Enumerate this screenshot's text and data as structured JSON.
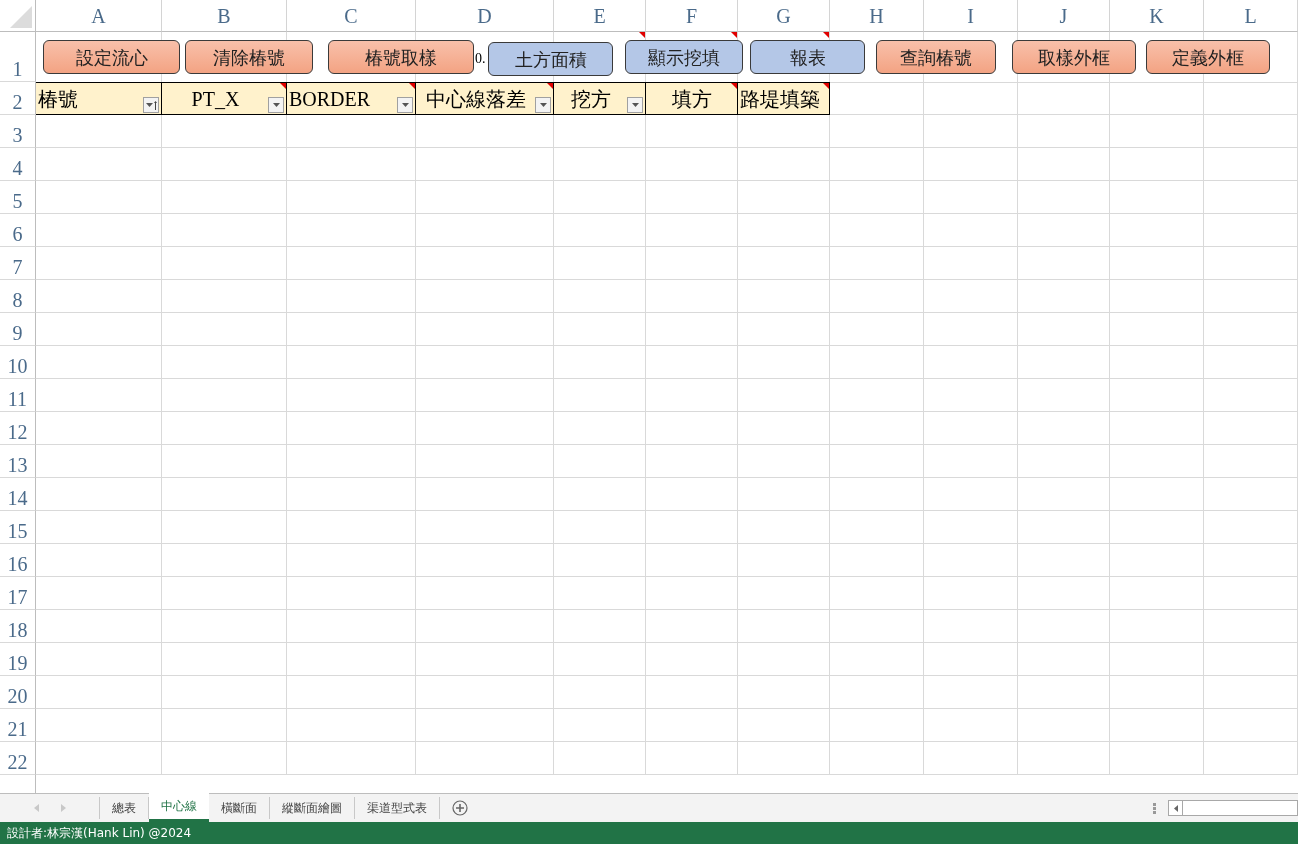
{
  "columns": [
    "A",
    "B",
    "C",
    "D",
    "E",
    "F",
    "G",
    "H",
    "I",
    "J",
    "K",
    "L"
  ],
  "row_numbers": [
    "1",
    "2",
    "3",
    "4",
    "5",
    "6",
    "7",
    "8",
    "9",
    "10",
    "11",
    "12",
    "13",
    "14",
    "15",
    "16",
    "17",
    "18",
    "19",
    "20",
    "21",
    "22"
  ],
  "row1_cells": [
    {
      "text": "0."
    },
    {
      "comment": true
    },
    {
      "comment": true
    },
    {
      "comment": true
    }
  ],
  "header_cells": [
    {
      "text": "椿號",
      "filter_button": true,
      "sorted": true,
      "comment": false
    },
    {
      "text": "PT_X",
      "filter_button": true,
      "sorted": false,
      "comment": true
    },
    {
      "text": "BORDER",
      "filter_button": true,
      "sorted": false,
      "comment": true
    },
    {
      "text": "中心線落差",
      "filter_button": true,
      "sorted": false,
      "comment": true
    },
    {
      "text": "挖方",
      "filter_button": true,
      "sorted": false,
      "comment": false
    },
    {
      "text": "填方",
      "filter_button": false,
      "comment": true
    },
    {
      "text": "路堤填築",
      "filter_button": false,
      "comment": true
    }
  ],
  "buttons": [
    {
      "label": "設定流心",
      "kind": "orange"
    },
    {
      "label": "清除椿號",
      "kind": "orange"
    },
    {
      "label": "椿號取樣",
      "kind": "orange"
    },
    {
      "label": "土方面積",
      "kind": "blue"
    },
    {
      "label": "顯示挖填",
      "kind": "blue"
    },
    {
      "label": "報表",
      "kind": "blue"
    },
    {
      "label": "查詢椿號",
      "kind": "orange"
    },
    {
      "label": "取樣外框",
      "kind": "orange"
    },
    {
      "label": "定義外框",
      "kind": "orange"
    }
  ],
  "sheet_tabs": [
    {
      "label": "總表",
      "selected": false
    },
    {
      "label": "中心線",
      "selected": true
    },
    {
      "label": "橫斷面",
      "selected": false
    },
    {
      "label": "縱斷面繪圖",
      "selected": false
    },
    {
      "label": "渠道型式表",
      "selected": false
    }
  ],
  "status_bar": {
    "text": "設計者:林宗漢(Hank Lin) @2024"
  }
}
